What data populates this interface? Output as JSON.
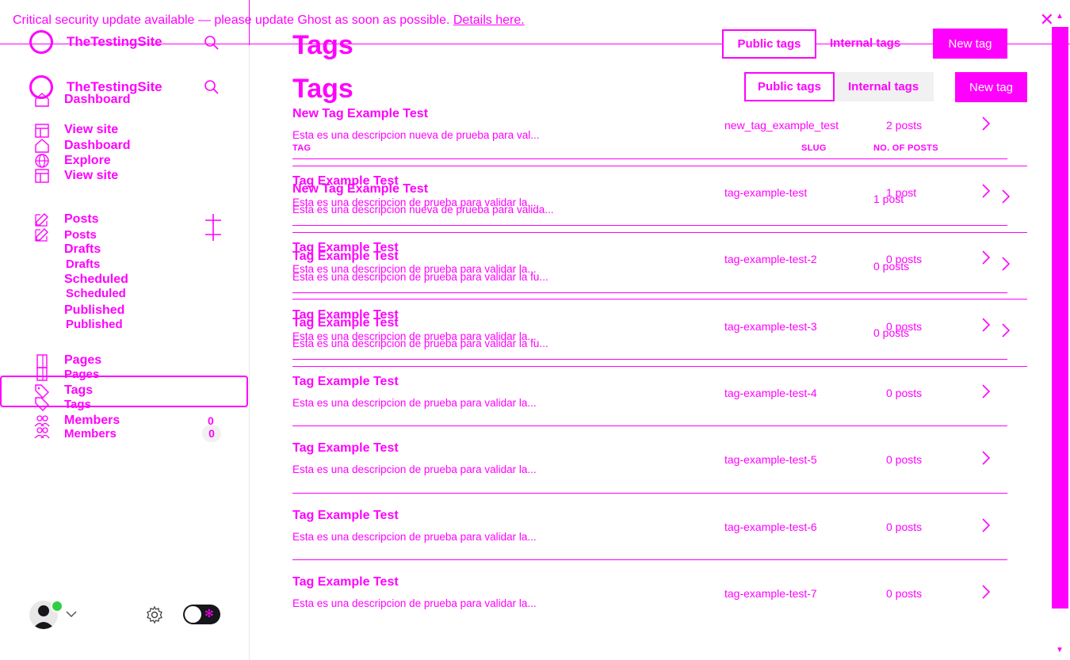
{
  "banner": {
    "text": "Critical security update available — please update Ghost as soon as possible.",
    "link": "Details here."
  },
  "site": {
    "name": "TheTestingSite"
  },
  "nav": {
    "dashboard": "Dashboard",
    "view_site": "View site",
    "explore": "Explore",
    "posts": "Posts",
    "drafts": "Drafts",
    "scheduled": "Scheduled",
    "published": "Published",
    "pages": "Pages",
    "tags": "Tags",
    "members": "Members",
    "members_count": "0"
  },
  "header": {
    "title": "Tags",
    "public_tab": "Public tags",
    "internal_tab": "Internal tags",
    "new_tag": "New tag"
  },
  "columns": {
    "tag": "TAG",
    "slug": "SLUG",
    "posts": "NO. OF POSTS"
  },
  "tags": [
    {
      "name": "New Tag Example Test",
      "description": "Esta es una descripcion nueva de prueba para val...",
      "slug": "new_tag_example_test",
      "posts": "2 posts"
    },
    {
      "name": "Tag Example Test",
      "description": "Esta es una descripcion de prueba para validar la...",
      "slug": "tag-example-test",
      "posts": "1 post"
    },
    {
      "name": "Tag Example Test",
      "description": "Esta es una descripcion de prueba para validar la...",
      "slug": "tag-example-test-2",
      "posts": "0 posts"
    },
    {
      "name": "Tag Example Test",
      "description": "Esta es una descripcion de prueba para validar la...",
      "slug": "tag-example-test-3",
      "posts": "0 posts"
    },
    {
      "name": "Tag Example Test",
      "description": "Esta es una descripcion de prueba para validar la...",
      "slug": "tag-example-test-4",
      "posts": "0 posts"
    },
    {
      "name": "Tag Example Test",
      "description": "Esta es una descripcion de prueba para validar la...",
      "slug": "tag-example-test-5",
      "posts": "0 posts"
    },
    {
      "name": "Tag Example Test",
      "description": "Esta es una descripcion de prueba para validar la...",
      "slug": "tag-example-test-6",
      "posts": "0 posts"
    },
    {
      "name": "Tag Example Test",
      "description": "Esta es una descripcion de prueba para validar la...",
      "slug": "tag-example-test-7",
      "posts": "0 posts"
    }
  ],
  "ghost_rows": [
    {
      "name": "New Tag Example Test",
      "description": "Esta es una descripcion nueva de prueba para valida...",
      "posts": "1 post"
    },
    {
      "name": "Tag Example Test",
      "description": "Esta es una descripcion de prueba para validar la fu...",
      "posts": "0 posts"
    },
    {
      "name": "Tag Example Test",
      "description": "Esta es una descripcion de prueba para validar la fu...",
      "posts": "0 posts"
    }
  ],
  "colors": {
    "accent": "#ff00ff",
    "online": "#30cf43",
    "dark": "#15171a"
  }
}
